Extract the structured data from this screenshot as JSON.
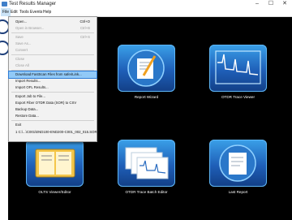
{
  "window": {
    "title": "Test Results Manager",
    "minimize": "–",
    "maximize": "☐",
    "close": "✕"
  },
  "menubar": [
    "File",
    "Edit",
    "Tools",
    "Events",
    "Help"
  ],
  "file_menu": [
    {
      "label": "Open...",
      "shortcut": "Ctrl+O",
      "disabled": false
    },
    {
      "label": "Open in Browser...",
      "shortcut": "Ctrl+B",
      "disabled": true
    },
    {
      "separator": true
    },
    {
      "label": "Save",
      "shortcut": "Ctrl+S",
      "disabled": true
    },
    {
      "label": "Save As...",
      "shortcut": "",
      "disabled": true
    },
    {
      "label": "Convert",
      "shortcut": "",
      "disabled": true
    },
    {
      "separator": true
    },
    {
      "label": "Close",
      "shortcut": "",
      "disabled": true
    },
    {
      "label": "Close All",
      "shortcut": "",
      "disabled": true
    },
    {
      "separator": true
    },
    {
      "label": "Download FastScan Files from saferiLink...",
      "shortcut": "",
      "disabled": false,
      "highlighted": true
    },
    {
      "label": "Import Results...",
      "shortcut": "",
      "disabled": false
    },
    {
      "label": "Import OFL Results...",
      "shortcut": "",
      "disabled": false
    },
    {
      "separator": true
    },
    {
      "label": "Export Job to File...",
      "shortcut": "",
      "disabled": false
    },
    {
      "label": "Export Fiber OTDR Data (SOR) to CSV",
      "shortcut": "",
      "disabled": false
    },
    {
      "label": "Backup Data...",
      "shortcut": "",
      "disabled": false
    },
    {
      "label": "Restore Data...",
      "shortcut": "",
      "disabled": false
    },
    {
      "separator": true
    },
    {
      "label": "Exit",
      "shortcut": "",
      "disabled": false
    },
    {
      "label": "1 C:\\...\\C001\\END100-END200-C001_002_015.SOR",
      "shortcut": "",
      "disabled": false
    }
  ],
  "tiles": [
    {
      "label": "Report Wizard",
      "icon": "report-wizard-icon"
    },
    {
      "label": "OTDR Trace Viewer",
      "icon": "otdr-trace-icon"
    },
    {
      "label": "OLTS Viewer/Editor",
      "icon": "olts-book-icon"
    },
    {
      "label": "OTDR Trace Batch Editor",
      "icon": "batch-editor-icon"
    },
    {
      "label": "Last Report",
      "icon": "last-report-icon"
    }
  ]
}
